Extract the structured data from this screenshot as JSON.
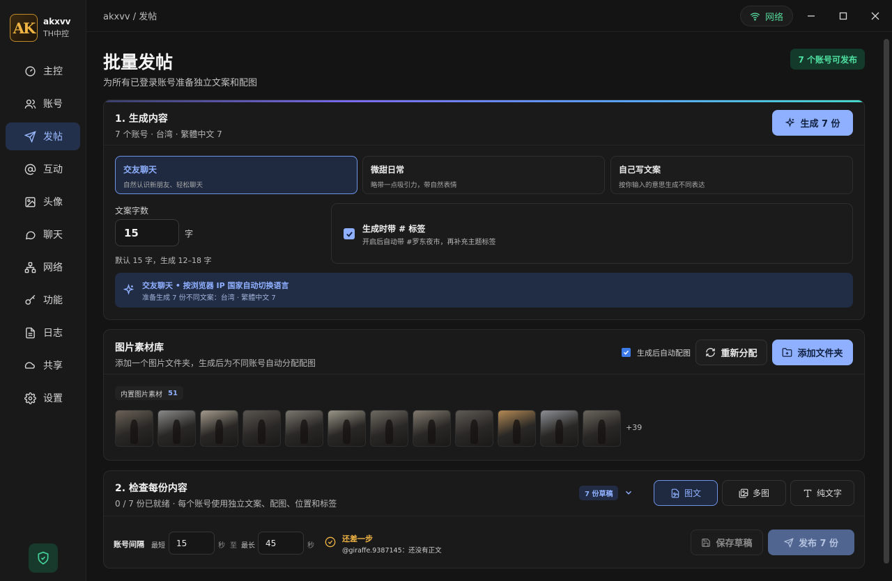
{
  "brand": {
    "logo_text": "AK",
    "name": "akxvv",
    "sub": "TH中控"
  },
  "sidebar": {
    "items": [
      {
        "label": "主控",
        "icon": "dashboard-icon"
      },
      {
        "label": "账号",
        "icon": "users-icon"
      },
      {
        "label": "发帖",
        "icon": "send-icon",
        "active": true
      },
      {
        "label": "互动",
        "icon": "at-icon"
      },
      {
        "label": "头像",
        "icon": "image-icon"
      },
      {
        "label": "聊天",
        "icon": "chat-icon"
      },
      {
        "label": "网络",
        "icon": "network-icon"
      },
      {
        "label": "功能",
        "icon": "key-icon"
      },
      {
        "label": "日志",
        "icon": "document-icon"
      },
      {
        "label": "共享",
        "icon": "cloud-icon"
      },
      {
        "label": "设置",
        "icon": "gear-icon"
      }
    ]
  },
  "topbar": {
    "breadcrumb": "akxvv / 发帖",
    "network_label": "网络"
  },
  "page": {
    "title": "批量发帖",
    "subtitle": "为所有已登录账号准备独立文案和配图",
    "available_badge": "7 个账号可发布"
  },
  "generate": {
    "title": "1. 生成内容",
    "subtitle": "7 个账号 · 台湾 · 繁體中文 7",
    "button": "生成 7 份",
    "modes": [
      {
        "title": "交友聊天",
        "desc": "自然认识新朋友、轻松聊天",
        "selected": true
      },
      {
        "title": "微甜日常",
        "desc": "略带一点吸引力，带自然表情",
        "selected": false
      },
      {
        "title": "自己写文案",
        "desc": "按你输入的意思生成不同表达",
        "selected": false
      }
    ],
    "word_count_label": "文案字数",
    "word_count_value": "15",
    "word_unit": "字",
    "word_hint": "默认 15 字，生成 12–18 字",
    "hashtag_title": "生成时带 # 标签",
    "hashtag_desc": "开启后自动带 #罗东夜市，再补充主题标签",
    "info_title": "交友聊天 • 按浏览器 IP 国家自动切换语言",
    "info_desc": "准备生成 7 份不同文案：台湾 · 繁體中文 7"
  },
  "library": {
    "title": "图片素材库",
    "subtitle": "添加一个图片文件夹，生成后为不同账号自动分配配图",
    "auto_label": "生成后自动配图",
    "reassign_button": "重新分配",
    "add_folder_button": "添加文件夹",
    "chip_label": "内置图片素材",
    "chip_count": "51",
    "more": "+39",
    "thumb_count": 12
  },
  "review": {
    "title": "2. 检查每份内容",
    "subtitle": "0 / 7 份已就绪 · 每个账号使用独立文案、配图、位置和标签",
    "drafts_badge": "7 份草稿",
    "views": [
      {
        "label": "图文",
        "icon": "image-text-icon",
        "selected": true
      },
      {
        "label": "多图",
        "icon": "gallery-icon",
        "selected": false
      },
      {
        "label": "纯文字",
        "icon": "text-icon",
        "selected": false
      }
    ],
    "interval_label": "账号间隔",
    "min_label": "最短",
    "min_value": "15",
    "sec1": "秒",
    "to_label": "至",
    "max_label": "最长",
    "max_value": "45",
    "sec2": "秒",
    "status_title": "还差一步",
    "status_desc": "@giraffe.9387145：还没有正文",
    "save_button": "保存草稿",
    "publish_button": "发布 7 份"
  },
  "colors": {
    "accent": "#8fb0ff",
    "green": "#4fe0a0",
    "warning": "#f0b444"
  }
}
